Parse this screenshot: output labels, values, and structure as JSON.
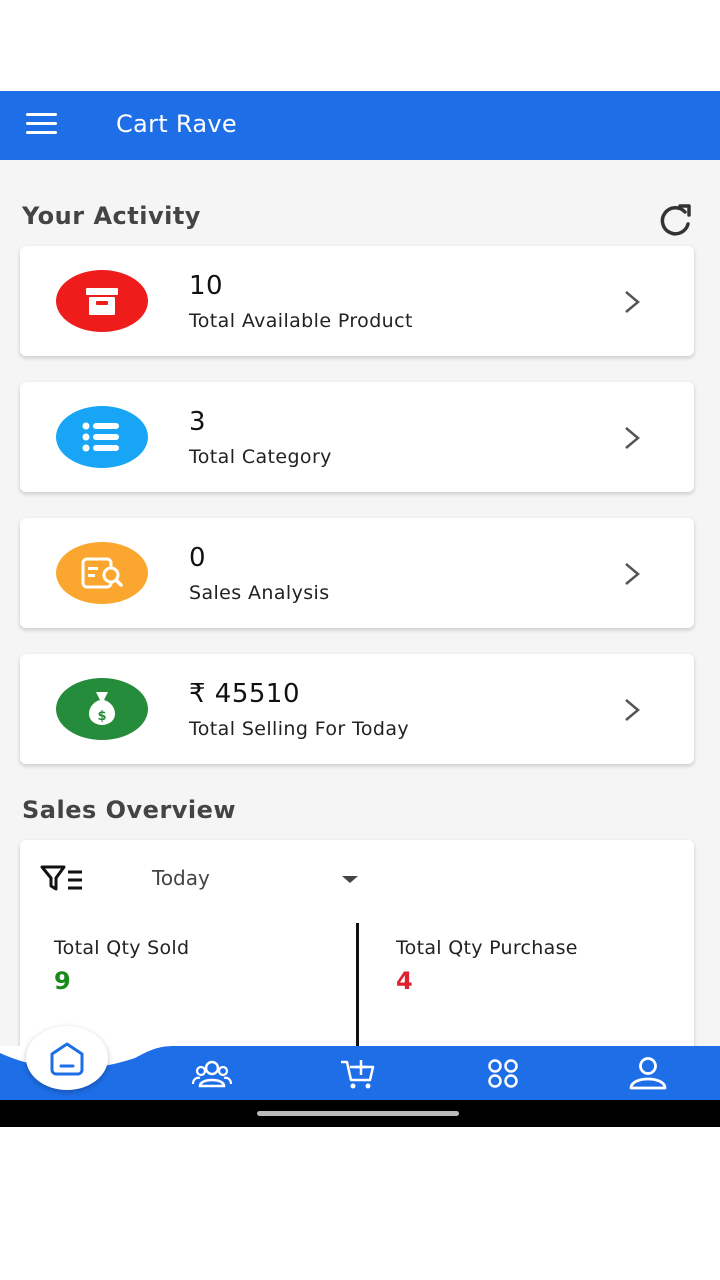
{
  "header": {
    "title": "Cart Rave",
    "color": "#1e6ee8"
  },
  "activity": {
    "title": "Your Activity",
    "cards": [
      {
        "value": "10",
        "label": "Total Available Product",
        "icon": "archive-box-icon",
        "color": "#ef1c1c"
      },
      {
        "value": "3",
        "label": "Total Category",
        "icon": "list-icon",
        "color": "#19a5f5"
      },
      {
        "value": "0",
        "label": "Sales Analysis",
        "icon": "document-search-icon",
        "color": "#fba72f"
      },
      {
        "value": "₹ 45510",
        "label": "Total Selling For Today",
        "icon": "money-bag-icon",
        "color": "#248c3a"
      }
    ]
  },
  "overview": {
    "title": "Sales Overview",
    "filter": {
      "selected": "Today"
    },
    "stats": [
      {
        "label": "Total Qty Sold",
        "value": "9",
        "color": "#1a8a1a"
      },
      {
        "label": "Total Qty Purchase",
        "value": "4",
        "color": "#e0202e"
      }
    ]
  },
  "bottom_nav": {
    "items": [
      "home-icon",
      "users-icon",
      "cart-add-icon",
      "grid-icon",
      "profile-icon"
    ]
  }
}
